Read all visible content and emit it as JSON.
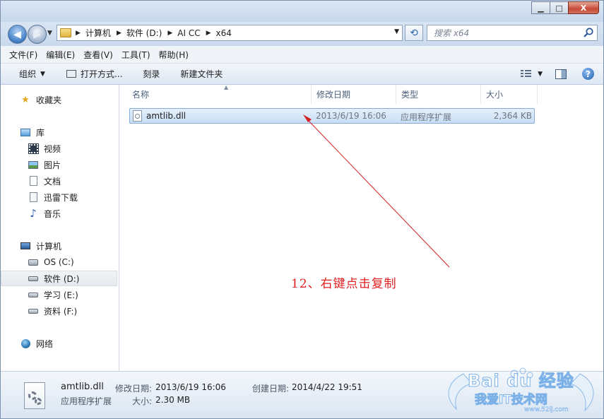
{
  "caption_buttons": {
    "minimize": "▁",
    "maximize": "□",
    "close": "X"
  },
  "address": {
    "crumbs": [
      "计算机",
      "软件 (D:)",
      "AI CC",
      "x64"
    ],
    "search_placeholder": "搜索 x64"
  },
  "menu": [
    "文件(F)",
    "编辑(E)",
    "查看(V)",
    "工具(T)",
    "帮助(H)"
  ],
  "toolbar": {
    "organize": "组织",
    "open_with": "打开方式...",
    "burn": "刻录",
    "new_folder": "新建文件夹"
  },
  "sidebar": {
    "favorites": "收藏夹",
    "libraries": "库",
    "library_items": [
      "视频",
      "图片",
      "文档",
      "迅雷下载",
      "音乐"
    ],
    "computer": "计算机",
    "drives": [
      "OS (C:)",
      "软件 (D:)",
      "学习 (E:)",
      "资料 (F:)"
    ],
    "network": "网络"
  },
  "columns": {
    "name": "名称",
    "modified": "修改日期",
    "type": "类型",
    "size": "大小"
  },
  "file": {
    "name": "amtlib.dll",
    "modified": "2013/6/19 16:06",
    "type": "应用程序扩展",
    "size": "2,364 KB"
  },
  "annotation": "12、右键点击复制",
  "details": {
    "name": "amtlib.dll",
    "type": "应用程序扩展",
    "modified_label": "修改日期:",
    "modified": "2013/6/19 16:06",
    "created_label": "创建日期:",
    "created": "2014/4/22 19:51",
    "size_label": "大小:",
    "size": "2.30 MB"
  },
  "watermark": {
    "main": "Bai du 经验",
    "sub": "我爱IT技术网",
    "url": "www.52ij.com"
  },
  "colors": {
    "annotation_red": "#e02020",
    "selection_blue": "#c9def5"
  }
}
